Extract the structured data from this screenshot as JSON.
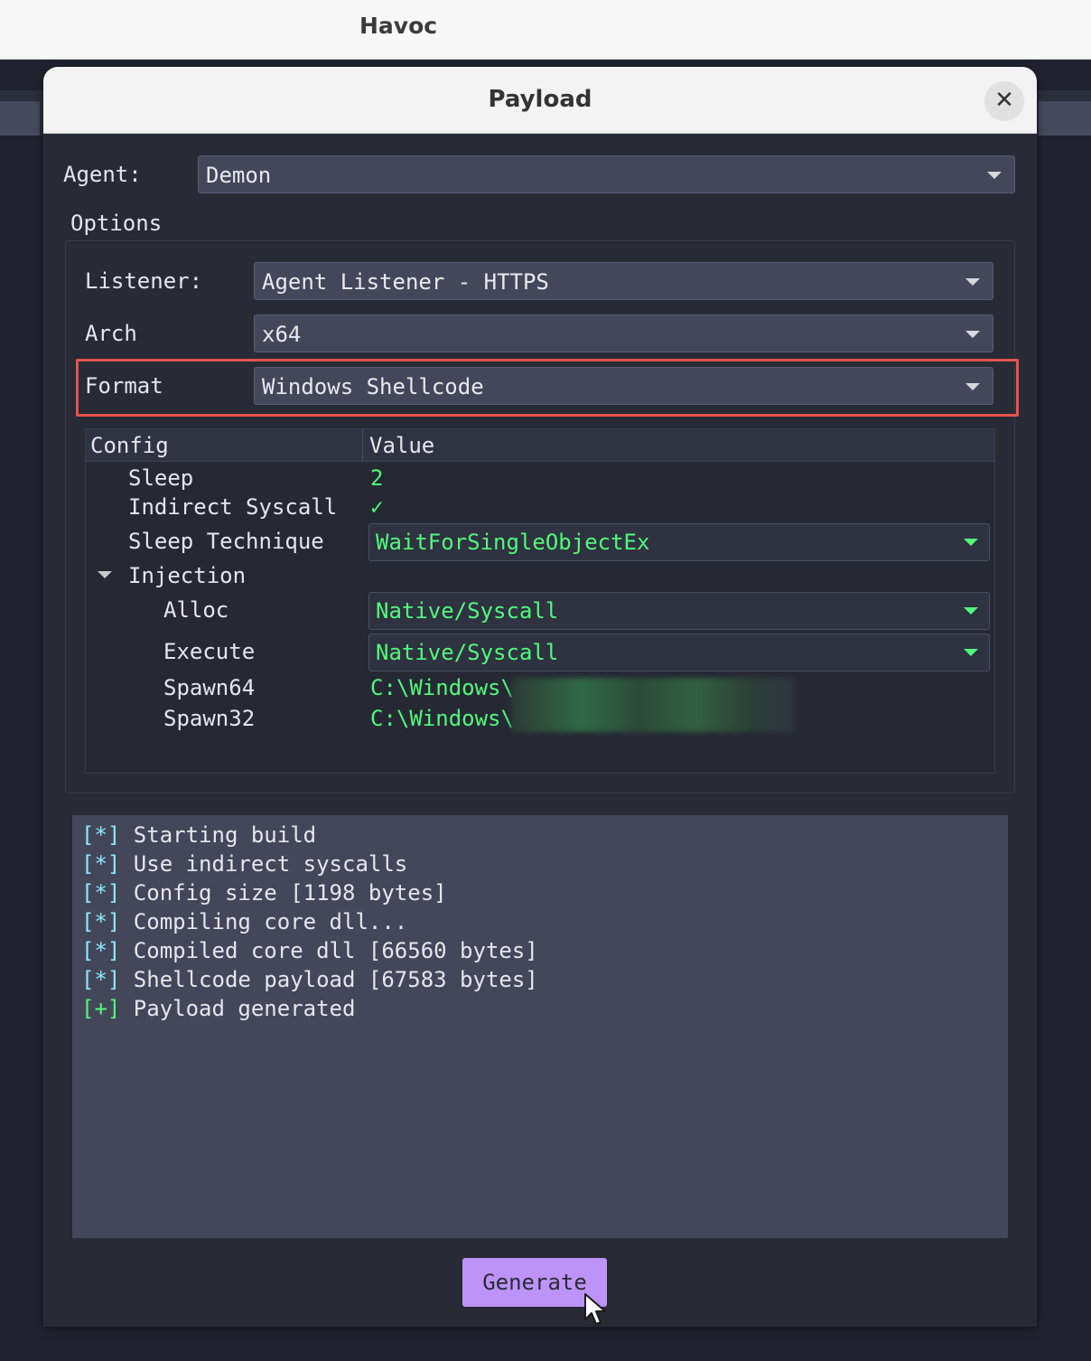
{
  "app": {
    "title": "Havoc"
  },
  "dialog": {
    "title": "Payload",
    "close_icon": "close-icon",
    "agent": {
      "label": "Agent:",
      "value": "Demon"
    },
    "options_label": "Options",
    "listener": {
      "label": "Listener:",
      "value": "Agent Listener - HTTPS"
    },
    "arch": {
      "label": "Arch",
      "value": "x64"
    },
    "format": {
      "label": "Format",
      "value": "Windows Shellcode"
    },
    "config": {
      "headers": {
        "config": "Config",
        "value": "Value"
      },
      "sleep": {
        "label": "Sleep",
        "value": "2"
      },
      "indirect_syscall": {
        "label": "Indirect Syscall",
        "value": "✓"
      },
      "sleep_technique": {
        "label": "Sleep Technique",
        "value": "WaitForSingleObjectEx"
      },
      "injection": {
        "label": "Injection"
      },
      "alloc": {
        "label": "Alloc",
        "value": "Native/Syscall"
      },
      "execute": {
        "label": "Execute",
        "value": "Native/Syscall"
      },
      "spawn64": {
        "label": "Spawn64",
        "value": "C:\\Windows\\"
      },
      "spawn32": {
        "label": "Spawn32",
        "value": "C:\\Windows\\"
      }
    },
    "log": [
      {
        "tag": "[*]",
        "text": " Starting build"
      },
      {
        "tag": "[*]",
        "text": " Use indirect syscalls"
      },
      {
        "tag": "[*]",
        "text": " Config size [1198 bytes]"
      },
      {
        "tag": "[*]",
        "text": " Compiling core dll..."
      },
      {
        "tag": "[*]",
        "text": " Compiled core dll [66560 bytes]"
      },
      {
        "tag": "[*]",
        "text": " Shellcode payload [67583 bytes]"
      },
      {
        "tag": "[+]",
        "text": " Payload generated"
      }
    ],
    "generate_label": "Generate"
  },
  "colors": {
    "accent": "#bd93f9",
    "success": "#50fa7b",
    "info": "#8be9fd",
    "highlight": "#e5534b"
  }
}
